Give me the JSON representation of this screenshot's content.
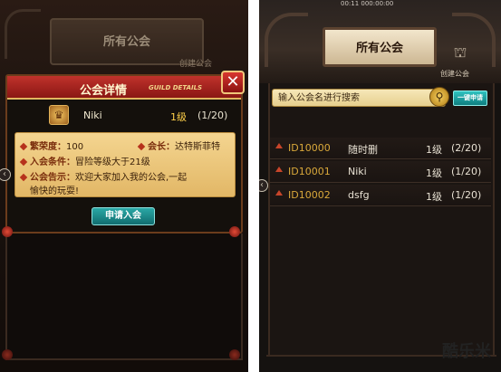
{
  "left": {
    "background_title": "所有公会",
    "background_create_label": "创建公会",
    "dialog": {
      "title": "公会详情",
      "title_en": "GUILD DETAILS",
      "close_label": "✕",
      "guild_icon": "guild-emblem-icon",
      "guild_name": "Niki",
      "guild_level": "1级",
      "guild_members": "(1/20)",
      "prosperity_key": "繁荣度：",
      "prosperity_value": "100",
      "leader_key": "会长：",
      "leader_value": "达特斯菲特",
      "condition_key": "入会条件：",
      "condition_value": "冒险等级大于21级",
      "notice_key": "公会告示：",
      "notice_value_line1": "欢迎大家加入我的公会,一起",
      "notice_value_line2": "愉快的玩耍!",
      "apply_button": "申请入会"
    }
  },
  "right": {
    "status_text": "00:11 000:00:00",
    "title": "所有公会",
    "create_label": "创建公会",
    "search": {
      "placeholder": "输入公会名进行搜索",
      "icon": "search-icon",
      "apply_all_button": "一键申请"
    },
    "guilds": [
      {
        "id": "ID10000",
        "name": "随时删",
        "level": "1级",
        "members": "(2/20)"
      },
      {
        "id": "ID10001",
        "name": "Niki",
        "level": "1级",
        "members": "(1/20)"
      },
      {
        "id": "ID10002",
        "name": "dsfg",
        "level": "1级",
        "members": "(1/20)"
      }
    ]
  },
  "watermark": "酷乐米",
  "colors": {
    "accent_red": "#c0322c",
    "gold": "#ffd04a",
    "teal_button": "#2aa8a5",
    "parchment": "#f4d590"
  }
}
